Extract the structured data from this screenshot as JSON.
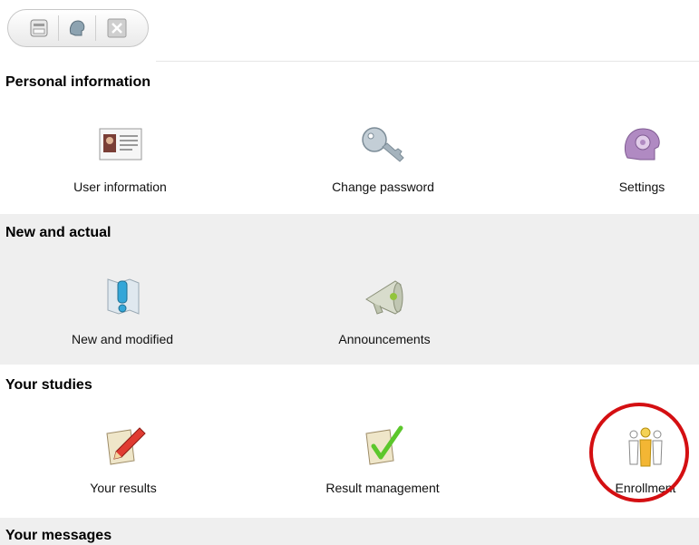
{
  "toolbar": {
    "buttons": [
      {
        "icon": "printer-icon"
      },
      {
        "icon": "profile-icon"
      },
      {
        "icon": "close-icon"
      }
    ]
  },
  "sections": {
    "personal": {
      "title": "Personal information",
      "items": [
        {
          "label": "User information",
          "icon": "id-card-icon"
        },
        {
          "label": "Change password",
          "icon": "key-icon"
        },
        {
          "label": "Settings",
          "icon": "gear-head-icon"
        }
      ]
    },
    "new": {
      "title": "New and actual",
      "items": [
        {
          "label": "New and modified",
          "icon": "exclamation-map-icon"
        },
        {
          "label": "Announcements",
          "icon": "megaphone-icon"
        }
      ]
    },
    "studies": {
      "title": "Your studies",
      "items": [
        {
          "label": "Your results",
          "icon": "pencil-clipboard-icon"
        },
        {
          "label": "Result management",
          "icon": "checkmark-clipboard-icon"
        },
        {
          "label": "Enrollment",
          "icon": "people-icon"
        }
      ]
    },
    "messages": {
      "title": "Your messages"
    }
  },
  "colors": {
    "band": "#efefef",
    "highlight_circle": "#d40f12"
  }
}
